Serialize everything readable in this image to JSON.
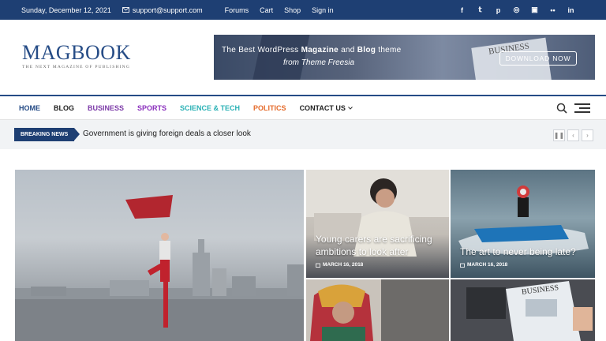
{
  "topbar": {
    "date": "Sunday, December 12, 2021",
    "email": "support@support.com",
    "links": [
      "Forums",
      "Cart",
      "Shop",
      "Sign in"
    ],
    "social_icons": [
      "facebook-icon",
      "twitter-icon",
      "pinterest-icon",
      "dribbble-icon",
      "instagram-icon",
      "flickr-icon",
      "linkedin-icon"
    ],
    "social_glyphs": [
      "f",
      "𝕥",
      "p",
      "◎",
      "▣",
      "••",
      "in"
    ]
  },
  "header": {
    "logo_name": "MAGBOOK",
    "logo_tagline": "THE NEXT MAGAZINE OF PUBLISHING",
    "banner": {
      "line1_pre": "The Best WordPress ",
      "line1_bold1": "Magazine",
      "line1_mid": " and ",
      "line1_bold2": "Blog",
      "line1_post": " theme",
      "line2": "from Theme Freesia",
      "button": "DOWNLOAD NOW",
      "paper_title": "BUSINESS"
    }
  },
  "nav": {
    "items": [
      "HOME",
      "BLOG",
      "BUSINESS",
      "SPORTS",
      "SCIENCE & TECH",
      "POLITICS",
      "CONTACT US"
    ]
  },
  "breaking": {
    "label": "BREAKING NEWS",
    "headline": "Government is giving foreign deals a closer look"
  },
  "posts": {
    "p2": {
      "title_line1": "Young carers are sacrificing",
      "title_line2": "ambitions to look after",
      "date": "MARCH 16, 2018"
    },
    "p3": {
      "title_line1": "The art to never being late?",
      "date": "MARCH 16, 2018"
    },
    "p5": {
      "paper_title": "BUSINESS"
    }
  },
  "colors": {
    "brand": "#1e3f73",
    "business": "#7c3aa8",
    "sports": "#8a2fbd",
    "science": "#2ab1b5",
    "politics": "#e56b2b"
  }
}
